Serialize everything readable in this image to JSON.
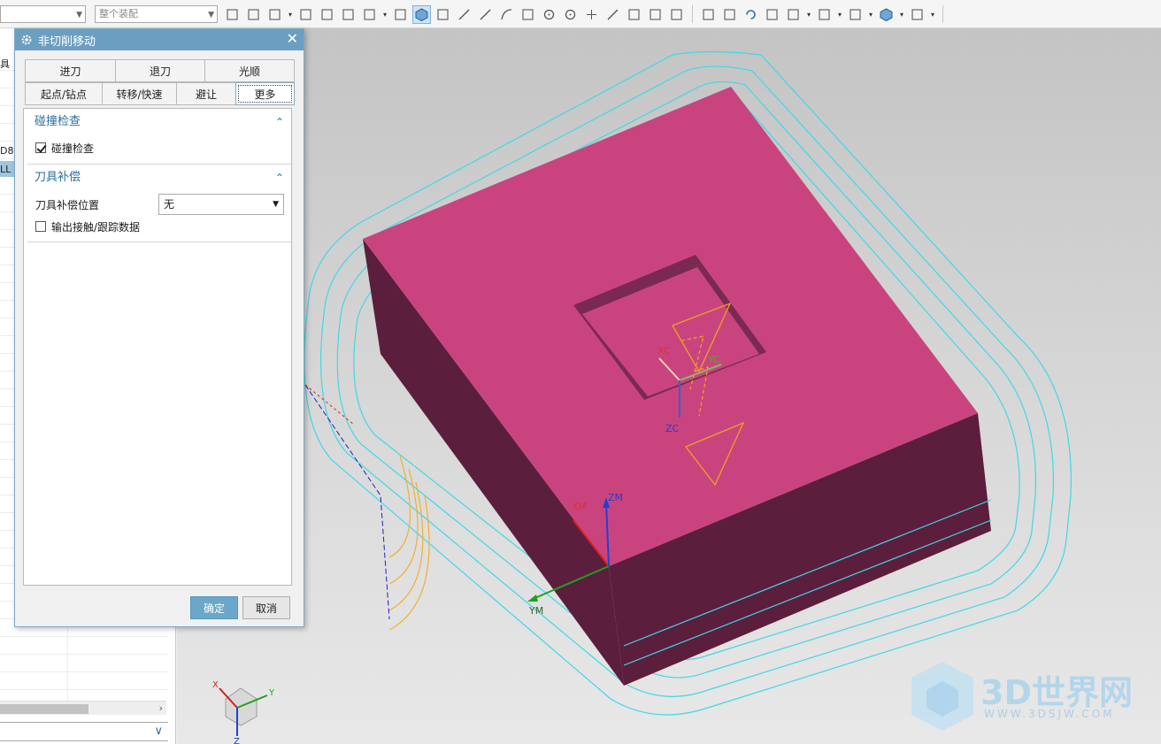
{
  "toolbar": {
    "combo_left": "",
    "combo_assembly": "整个装配",
    "icons": [
      "select-filter-icon",
      "snap-icon",
      "point-add-icon",
      "curve-icon",
      "face-icon",
      "body-icon",
      "rect-select-icon",
      "shaded-icon",
      "solid-view-icon",
      "point-cloud-icon",
      "line-icon",
      "angled-line-icon",
      "arc-icon",
      "intersect-icon",
      "circle-center-icon",
      "quadrant-icon",
      "plus-point-icon",
      "line-tool-icon",
      "surface-icon",
      "faces-icon",
      "table-icon"
    ],
    "icons_right": [
      "fit-view-icon",
      "zoom-region-icon",
      "rotate-icon",
      "brush-icon",
      "layers-icon",
      "display-icon",
      "render-icon",
      "cube-view-icon",
      "color-icon"
    ]
  },
  "left_panel": {
    "partial_labels": [
      "具",
      "D8",
      "LL"
    ]
  },
  "dialog": {
    "title": "非切削移动",
    "tabs_row1": [
      "进刀",
      "退刀",
      "光顺"
    ],
    "tabs_row2": [
      "起点/钻点",
      "转移/快速",
      "避让",
      "更多"
    ],
    "active_tab": "更多",
    "section_collision": {
      "title": "碰撞检查",
      "checkbox_label": "碰撞检查",
      "checked": true
    },
    "section_compensation": {
      "title": "刀具补偿",
      "position_label": "刀具补偿位置",
      "position_value": "无",
      "output_label": "输出接触/跟踪数据",
      "output_checked": false
    },
    "ok_label": "确定",
    "cancel_label": "取消"
  },
  "viewport": {
    "wcs_labels": [
      "XC",
      "YC",
      "ZC"
    ],
    "mcs_labels": [
      "XM",
      "YM",
      "ZM"
    ],
    "triad_labels": [
      "X",
      "Y",
      "Z"
    ],
    "colors": {
      "top_face": "#c9447f",
      "side_face": "#5c1e3d",
      "toolpath_cyan": "#3fd8e6",
      "tool_orange": "#f0a020"
    }
  },
  "watermark": {
    "brand": "3D世界网",
    "url": "WWW.3DSJW.COM"
  }
}
